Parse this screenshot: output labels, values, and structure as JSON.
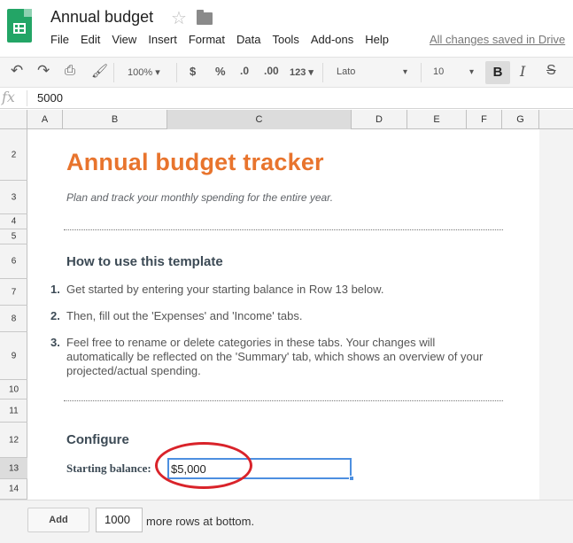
{
  "header": {
    "title": "Annual budget",
    "menu": [
      "File",
      "Edit",
      "View",
      "Insert",
      "Format",
      "Data",
      "Tools",
      "Add-ons",
      "Help"
    ],
    "save_status": "All changes saved in Drive"
  },
  "toolbar": {
    "zoom": "100%",
    "currency": "$",
    "percent": "%",
    "dec_decrease": ".0",
    "dec_increase": ".00",
    "more_formats": "123",
    "font": "Lato",
    "font_size": "10",
    "bold": "B",
    "italic": "I",
    "strike": "S"
  },
  "formula_bar": {
    "fx": "fx",
    "value": "5000"
  },
  "columns": [
    "A",
    "B",
    "C",
    "D",
    "E",
    "F",
    "G"
  ],
  "rows": [
    "2",
    "3",
    "4",
    "5",
    "6",
    "7",
    "8",
    "9",
    "10",
    "11",
    "12",
    "13",
    "14"
  ],
  "sheet": {
    "title": "Annual budget tracker",
    "subtitle": "Plan and track your monthly spending for the entire year.",
    "how_to_heading": "How to use this template",
    "steps": [
      {
        "num": "1.",
        "text": "Get started by entering your starting balance in Row 13 below."
      },
      {
        "num": "2.",
        "text": "Then, fill out the 'Expenses' and 'Income' tabs."
      },
      {
        "num": "3.",
        "text": "Feel free to rename or delete categories in these tabs. Your changes will automatically be reflected on the 'Summary' tab, which shows an overview of your projected/actual spending."
      }
    ],
    "configure_heading": "Configure",
    "starting_balance_label": "Starting balance:",
    "starting_balance_value": "$5,000"
  },
  "bottom": {
    "add_label": "Add",
    "rows_value": "1000",
    "rows_label": "more rows at bottom."
  },
  "colors": {
    "accent": "#e8742d",
    "sheets_green": "#23a566",
    "selection_blue": "#4d8fe0",
    "annotation_red": "#d9232a"
  }
}
